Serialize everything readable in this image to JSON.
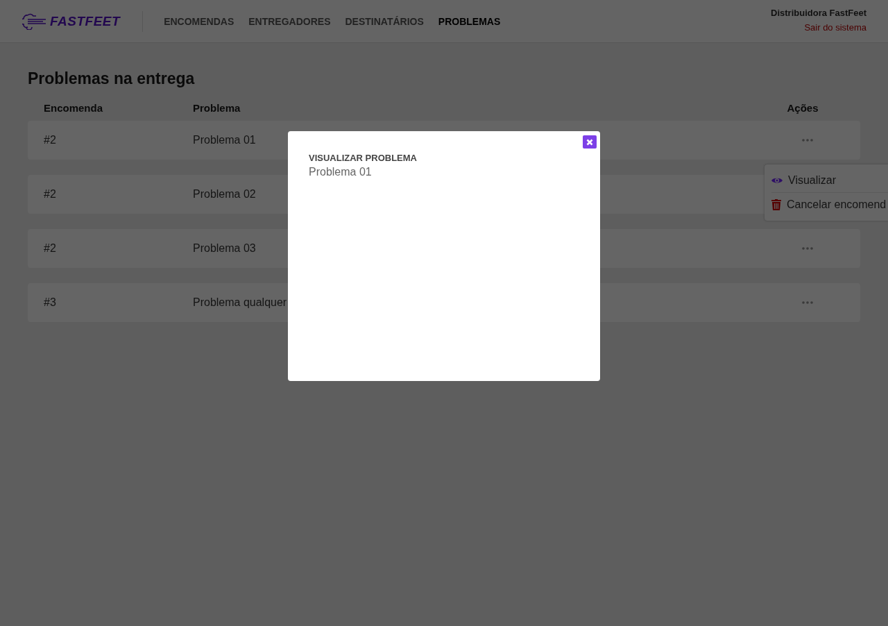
{
  "header": {
    "logo": "FASTFEET",
    "nav": [
      {
        "label": "ENCOMENDAS",
        "selected": false
      },
      {
        "label": "ENTREGADORES",
        "selected": false
      },
      {
        "label": "DESTINATÁRIOS",
        "selected": false
      },
      {
        "label": "PROBLEMAS",
        "selected": true
      }
    ],
    "user": "Distribuidora FastFeet",
    "logout": "Sair do sistema"
  },
  "page_title": "Problemas na entrega",
  "table": {
    "columns": [
      "Encomenda",
      "Problema",
      "Ações"
    ],
    "rows": [
      {
        "order": "#2",
        "problem": "Problema 01"
      },
      {
        "order": "#2",
        "problem": "Problema 02"
      },
      {
        "order": "#2",
        "problem": "Problema 03"
      },
      {
        "order": "#3",
        "problem": "Problema qualquer"
      }
    ]
  },
  "action_menu": [
    {
      "kind": "view",
      "label": "Visualizar"
    },
    {
      "kind": "cancel",
      "label": "Cancelar encomend"
    }
  ],
  "modal": {
    "title": "VISUALIZAR PROBLEMA",
    "text": "Problema 01"
  }
}
